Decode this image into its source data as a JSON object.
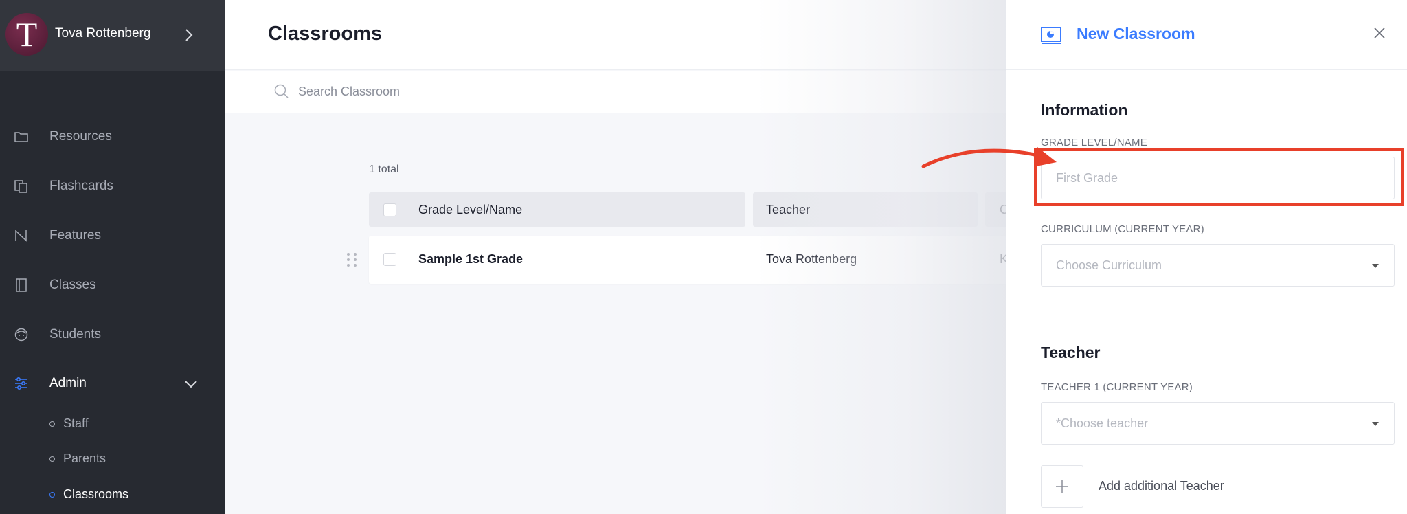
{
  "user": {
    "initial": "T",
    "name": "Tova Rottenberg"
  },
  "nav": {
    "resources": "Resources",
    "flashcards": "Flashcards",
    "features": "Features",
    "classes": "Classes",
    "students": "Students",
    "admin": "Admin",
    "admin_sub": {
      "staff": "Staff",
      "parents": "Parents",
      "classrooms": "Classrooms"
    }
  },
  "main": {
    "title": "Classrooms",
    "search_placeholder": "Search Classroom",
    "total": "1 total",
    "columns": [
      "Grade Level/Name",
      "Teacher",
      "C"
    ],
    "rows": [
      {
        "name": "Sample 1st Grade",
        "teacher": "Tova Rottenberg",
        "third": "K"
      }
    ]
  },
  "panel": {
    "title": "New Classroom",
    "information_title": "Information",
    "grade_label": "GRADE LEVEL/NAME",
    "grade_placeholder": "First Grade",
    "curriculum_label": "CURRICULUM (CURRENT YEAR)",
    "curriculum_placeholder": "Choose Curriculum",
    "teacher_title": "Teacher",
    "teacher1_label": "TEACHER 1 (CURRENT YEAR)",
    "teacher1_placeholder": "*Choose teacher",
    "add_teacher": "Add additional Teacher"
  },
  "colors": {
    "accent": "#3b7cff",
    "annotation": "#e8402a",
    "sidebar": "#272a31"
  },
  "icons": [
    "chevron-right-icon",
    "folder-icon",
    "flashcards-icon",
    "features-icon",
    "book-icon",
    "student-icon",
    "sliders-icon",
    "chevron-down-icon",
    "search-icon",
    "drag-handle-icon",
    "classroom-board-icon",
    "close-icon",
    "plus-icon",
    "arrow-icon"
  ]
}
